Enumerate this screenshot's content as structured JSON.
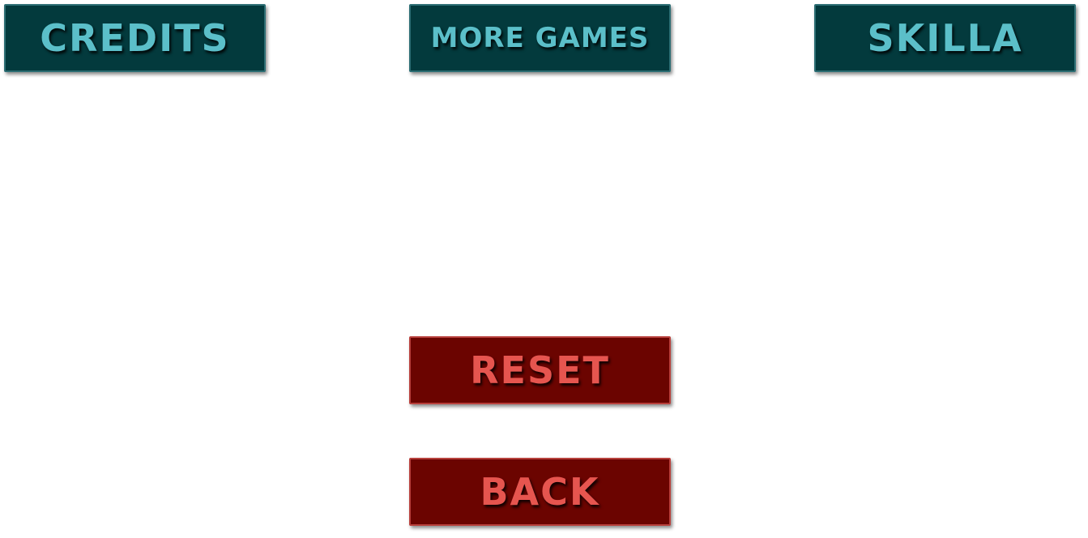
{
  "buttons": {
    "credits": "Credits",
    "more_games": "More Games",
    "skilla": "Skilla",
    "reset": "Reset",
    "back": "Back"
  },
  "colors": {
    "teal_button_bg": "#033a3d",
    "teal_button_text": "#5bbfc9",
    "red_button_bg": "#6b0400",
    "red_button_text": "#e6554f",
    "page_bg": "#ffffff"
  }
}
